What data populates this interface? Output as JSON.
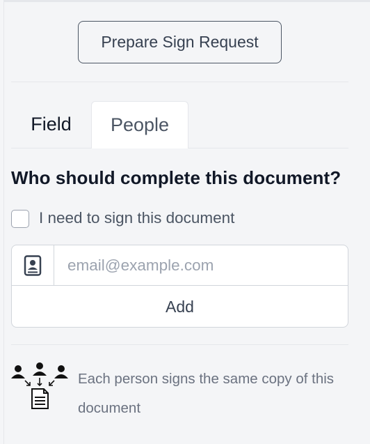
{
  "toolbar": {
    "prepare_label": "Prepare Sign Request"
  },
  "tabs": [
    {
      "label": "Field",
      "active": false
    },
    {
      "label": "People",
      "active": true
    }
  ],
  "people": {
    "question": "Who should complete this document?",
    "self_sign_label": "I need to sign this document",
    "self_sign_checked": false,
    "email_placeholder": "email@example.com",
    "email_value": "",
    "add_label": "Add",
    "info_text": "Each person signs the same copy of this document"
  },
  "icons": {
    "contact": "contact-book-icon",
    "group": "people-signing-document-icon"
  }
}
